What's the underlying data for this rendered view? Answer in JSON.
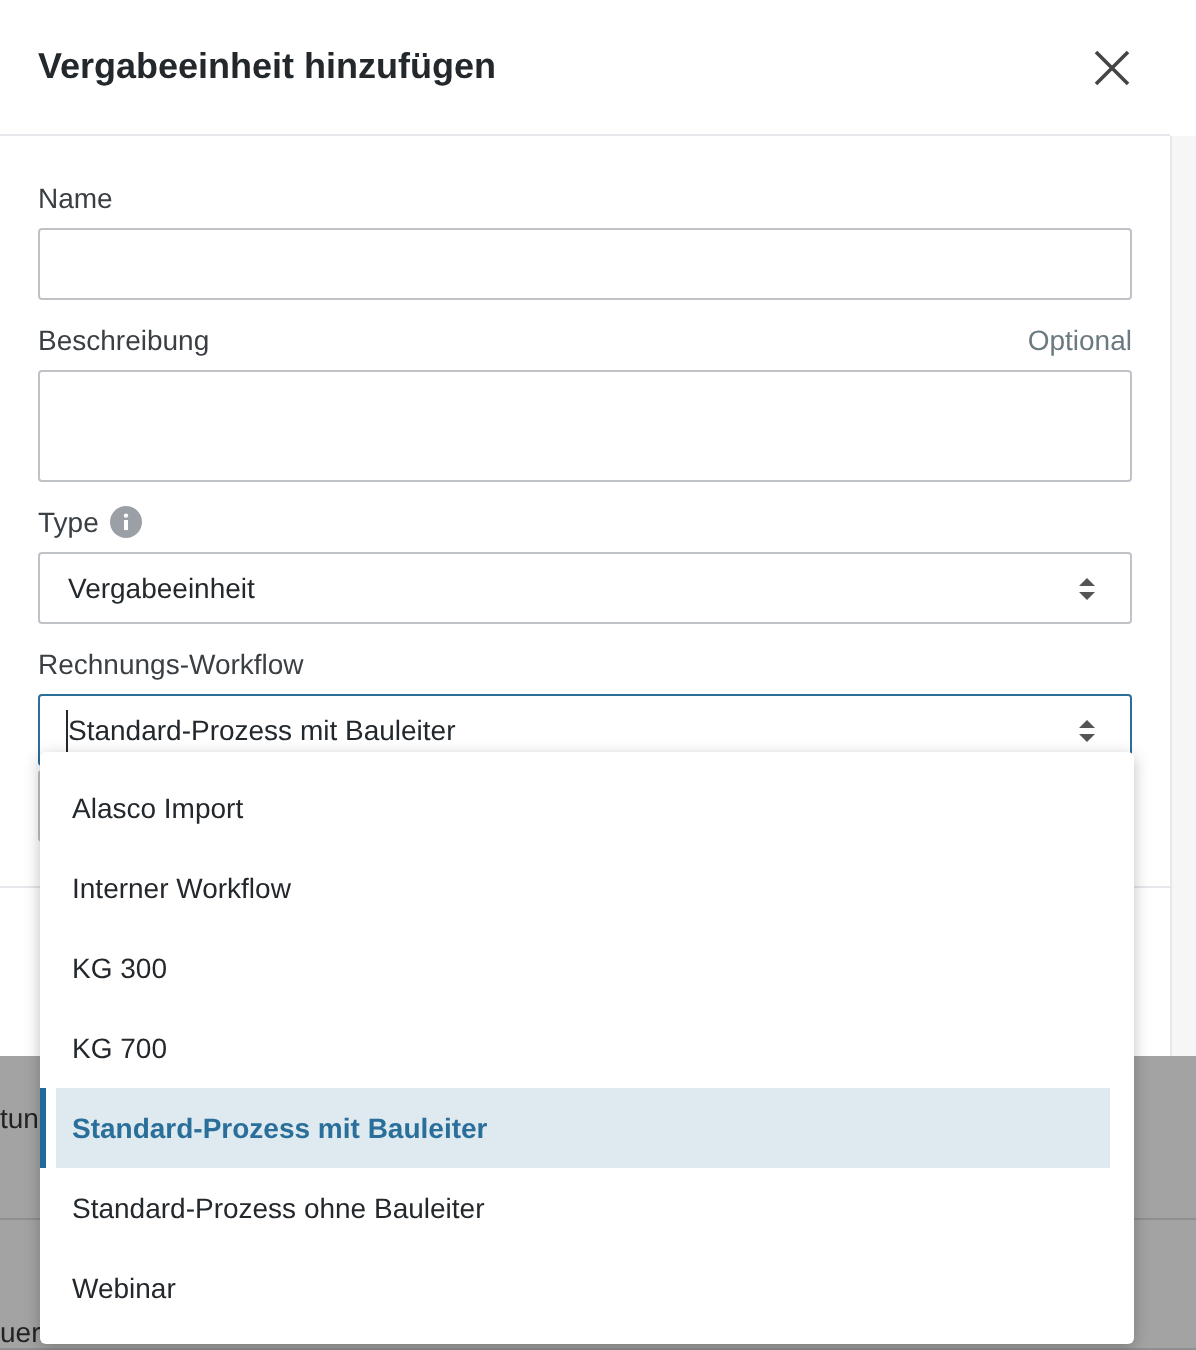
{
  "dialog": {
    "title": "Vergabeeinheit hinzufügen"
  },
  "fields": [
    {
      "kind": "text",
      "label": "Name"
    },
    {
      "kind": "textarea",
      "label": "Beschreibung",
      "hint": "Optional"
    },
    {
      "kind": "select",
      "label": "Type",
      "info": true,
      "value": "Vergabeeinheit",
      "focused": false
    },
    {
      "kind": "select",
      "label": "Rechnungs-Workflow",
      "info": false,
      "value": "Standard-Prozess mit Bauleiter",
      "focused": true
    }
  ],
  "dropdown": {
    "options": [
      {
        "label": "Alasco Import",
        "selected": false
      },
      {
        "label": "Interner Workflow",
        "selected": false
      },
      {
        "label": "KG 300",
        "selected": false
      },
      {
        "label": "KG 700",
        "selected": false
      },
      {
        "label": "Standard-Prozess mit Bauleiter",
        "selected": true
      },
      {
        "label": "Standard-Prozess ohne Bauleiter",
        "selected": false
      },
      {
        "label": "Webinar",
        "selected": false
      }
    ]
  },
  "background_table": {
    "row_labels": [
      "tun",
      "uer"
    ]
  }
}
